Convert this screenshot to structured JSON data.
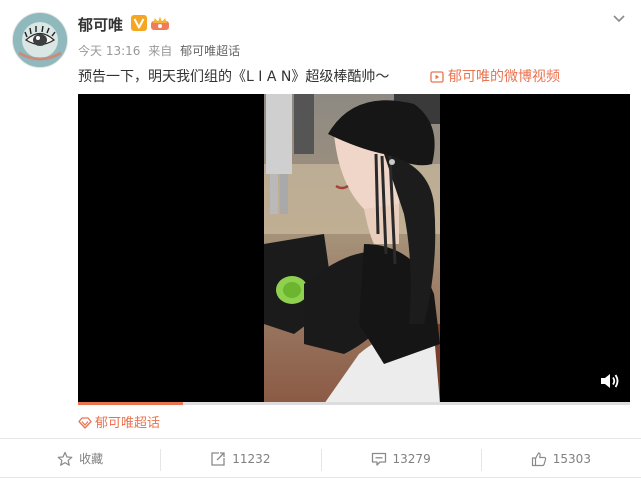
{
  "post": {
    "username": "郁可唯",
    "time": "今天 13:16",
    "source_prefix": "来自",
    "source": "郁可唯超话",
    "text": "预告一下，明天我们组的《L I A N》超级棒酷帅～",
    "video_link": "郁可唯的微博视频",
    "topic": "郁可唯超话"
  },
  "video": {
    "progress": 0.19
  },
  "actions": {
    "favorite_label": "收藏",
    "repost_count": "11232",
    "comment_count": "13279",
    "like_count": "15303"
  },
  "icons": {
    "verified": "verified-v-icon",
    "member": "crown-icon",
    "dropdown": "chevron-down-icon",
    "video": "video-icon",
    "volume": "volume-icon",
    "topic": "diamond-icon",
    "favorite": "star-icon",
    "repost": "repost-icon",
    "comment": "comment-icon",
    "like": "thumbs-up-icon"
  },
  "colors": {
    "accent": "#eb7350",
    "text": "#333333",
    "muted": "#999999"
  }
}
